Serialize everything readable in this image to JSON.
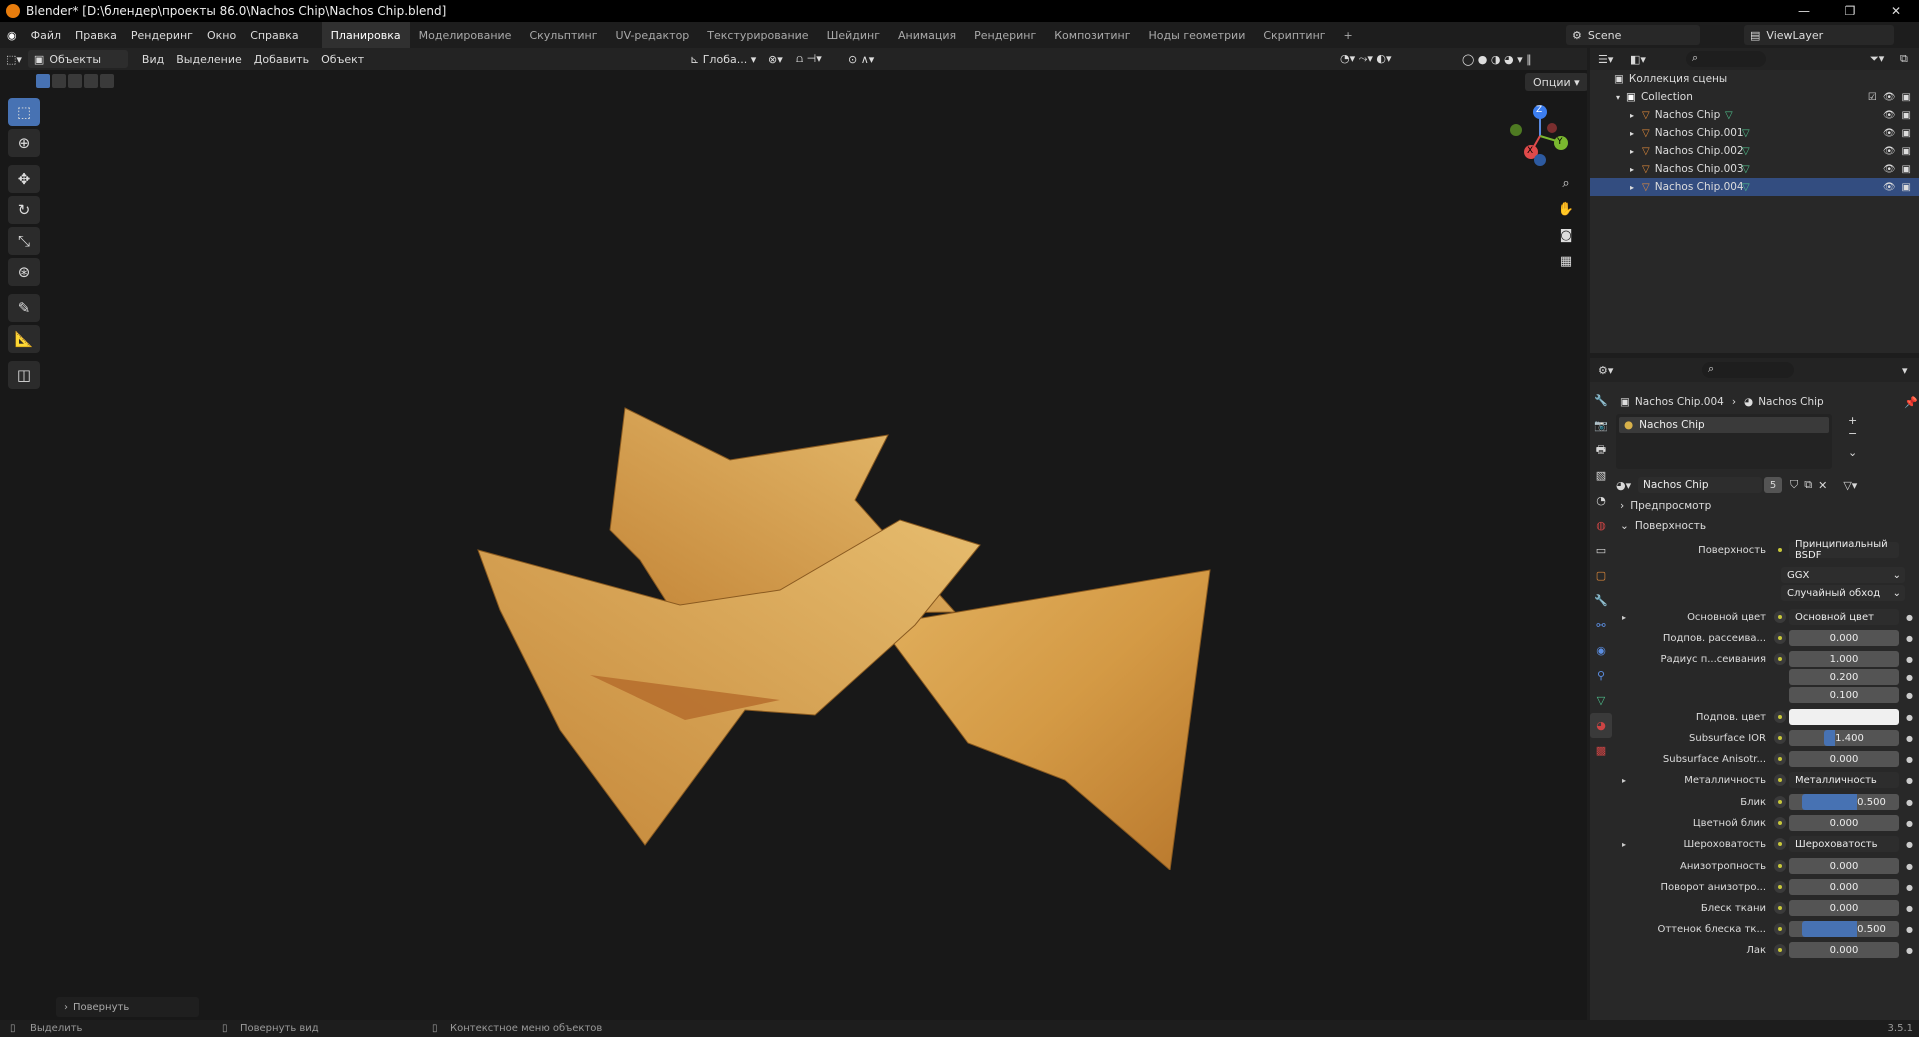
{
  "window": {
    "title": "Blender* [D:\\блендер\\проекты 86.0\\Nachos Chip\\Nachos Chip.blend]",
    "controls": [
      "—",
      "❐",
      "✕"
    ]
  },
  "menu": [
    "Файл",
    "Правка",
    "Рендеринг",
    "Окно",
    "Справка"
  ],
  "workspaces": [
    "Планировка",
    "Моделирование",
    "Скульптинг",
    "UV-редактор",
    "Текстурирование",
    "Шейдинг",
    "Анимация",
    "Рендеринг",
    "Композитинг",
    "Ноды геометрии",
    "Скриптинг",
    "+"
  ],
  "scene": "Scene",
  "view_layer": "ViewLayer",
  "viewport_header": {
    "mode": "Объекты",
    "menus": [
      "Вид",
      "Выделение",
      "Добавить",
      "Объект"
    ],
    "transform": "Глоба...",
    "options": "Опции"
  },
  "gizmo": {
    "x": "X",
    "y": "Y",
    "z": "Z"
  },
  "operator_panel": "Повернуть",
  "statusbar": {
    "left": "Выделить",
    "mid": "Повернуть вид",
    "right": "Контекстное меню объектов",
    "version": "3.5.1"
  },
  "outliner": {
    "title": "Коллекция сцены",
    "collection": "Collection",
    "items": [
      {
        "name": "Nachos Chip",
        "selected": false
      },
      {
        "name": "Nachos Chip.001",
        "selected": false
      },
      {
        "name": "Nachos Chip.002",
        "selected": false
      },
      {
        "name": "Nachos Chip.003",
        "selected": false
      },
      {
        "name": "Nachos Chip.004",
        "selected": true
      }
    ]
  },
  "properties": {
    "breadcrumb_object": "Nachos Chip.004",
    "breadcrumb_material": "Nachos Chip",
    "slot": "Nachos Chip",
    "material_name": "Nachos Chip",
    "users": "5",
    "sections": {
      "preview": "Предпросмотр",
      "surface": "Поверхность"
    },
    "surface_label": "Поверхность",
    "surface_value": "Принципиальный BSDF",
    "distribution": "GGX",
    "subsurface_method": "Случайный обход",
    "rows": [
      {
        "label": "Основной цвет",
        "value": "Основной цвет",
        "type": "link"
      },
      {
        "label": "Подпов. рассеива...",
        "value": "0.000",
        "type": "num"
      },
      {
        "label": "Радиус п...сеивания",
        "value": "1.000",
        "type": "num"
      },
      {
        "label": "",
        "value": "0.200",
        "type": "num"
      },
      {
        "label": "",
        "value": "0.100",
        "type": "num"
      },
      {
        "label": "Подпов. цвет",
        "value": "",
        "type": "color"
      },
      {
        "label": "Subsurface IOR",
        "value": "1.400",
        "type": "num",
        "fill": 0.1
      },
      {
        "label": "Subsurface Anisotr...",
        "value": "0.000",
        "type": "num"
      },
      {
        "label": "Металличность",
        "value": "Металличность",
        "type": "link"
      },
      {
        "label": "Блик",
        "value": "0.500",
        "type": "num",
        "fill": 0.5
      },
      {
        "label": "Цветной блик",
        "value": "0.000",
        "type": "num"
      },
      {
        "label": "Шероховатость",
        "value": "Шероховатость",
        "type": "link"
      },
      {
        "label": "Анизотропность",
        "value": "0.000",
        "type": "num"
      },
      {
        "label": "Поворот анизотро...",
        "value": "0.000",
        "type": "num"
      },
      {
        "label": "Блеск ткани",
        "value": "0.000",
        "type": "num"
      },
      {
        "label": "Оттенок блеска тк...",
        "value": "0.500",
        "type": "num",
        "fill": 0.5
      },
      {
        "label": "Лак",
        "value": "0.000",
        "type": "num"
      }
    ]
  }
}
